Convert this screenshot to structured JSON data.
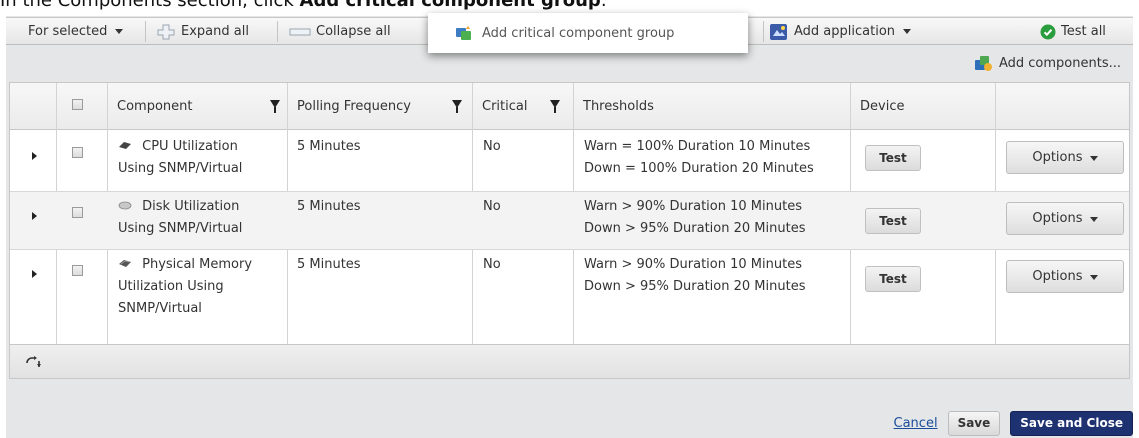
{
  "instruction": {
    "prefix": "In the Components section, click ",
    "bold": "Add critical component group",
    "suffix": "."
  },
  "toolbar": {
    "for_selected": "For selected",
    "expand_all": "Expand all",
    "collapse_all": "Collapse all",
    "add_critical_group": "Add critical component group",
    "add_application": "Add application",
    "test_all": "Test all"
  },
  "subbar": {
    "add_components": "Add components..."
  },
  "grid": {
    "columns": {
      "component": "Component",
      "polling_frequency": "Polling Frequency",
      "critical": "Critical",
      "thresholds": "Thresholds",
      "device": "Device"
    },
    "rows": [
      {
        "component_line1": "CPU Utilization",
        "component_line2": "Using SNMP/Virtual",
        "component_line3": "",
        "polling": "5 Minutes",
        "critical": "No",
        "warn": "Warn = 100% Duration 10 Minutes",
        "down": "Down = 100% Duration 20 Minutes",
        "test": "Test",
        "options": "Options"
      },
      {
        "component_line1": "Disk Utilization",
        "component_line2": "Using SNMP/Virtual",
        "component_line3": "",
        "polling": "5 Minutes",
        "critical": "No",
        "warn": "Warn > 90% Duration 10 Minutes",
        "down": "Down > 95% Duration 20 Minutes",
        "test": "Test",
        "options": "Options"
      },
      {
        "component_line1": "Physical Memory",
        "component_line2": "Utilization Using",
        "component_line3": "SNMP/Virtual",
        "polling": "5 Minutes",
        "critical": "No",
        "warn": "Warn > 90% Duration 10 Minutes",
        "down": "Down > 95% Duration 20 Minutes",
        "test": "Test",
        "options": "Options"
      }
    ]
  },
  "footer": {
    "cancel": "Cancel",
    "save": "Save",
    "save_and_close": "Save and Close"
  },
  "colors": {
    "primary_button": "#1e3170",
    "link": "#1a4e9b",
    "success_icon": "#2a9d3c"
  }
}
